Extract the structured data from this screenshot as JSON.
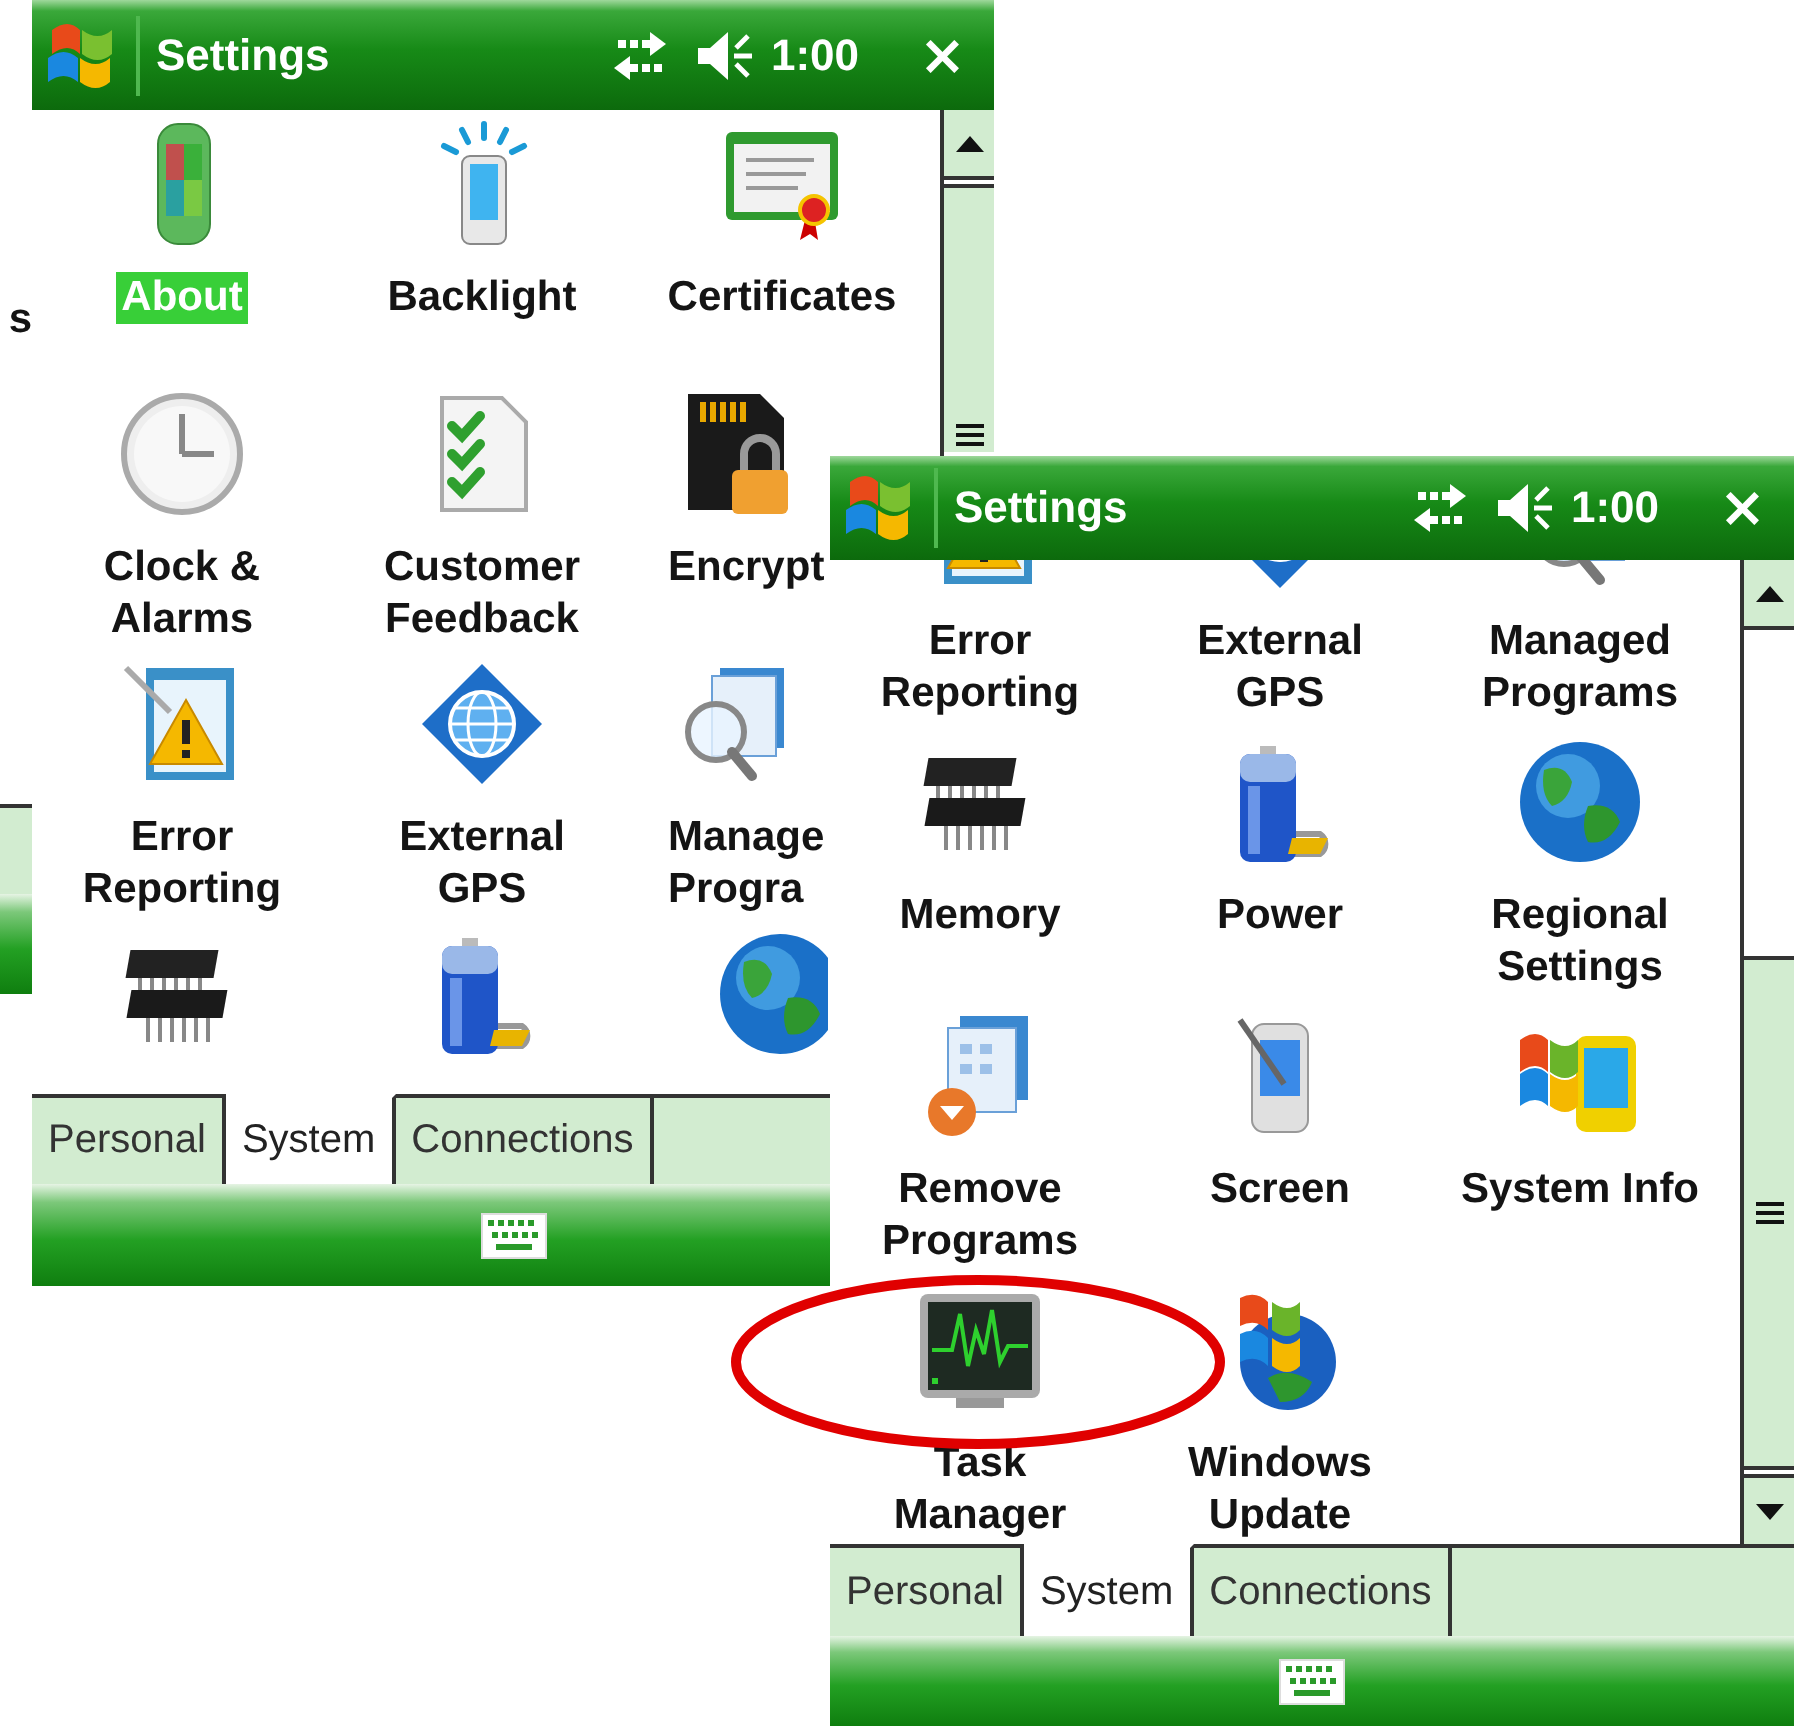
{
  "background_window": {
    "label": "s"
  },
  "windows": [
    {
      "title": "Settings",
      "time": "1:00",
      "close": "×",
      "items": [
        {
          "label": "About",
          "selected": true
        },
        {
          "label": "Backlight",
          "selected": false
        },
        {
          "label": "Certificates",
          "selected": false
        },
        {
          "label": "Clock &\nAlarms",
          "selected": false
        },
        {
          "label": "Customer\nFeedback",
          "selected": false
        },
        {
          "label": "Encrypt",
          "selected": false
        },
        {
          "label": "Error\nReporting",
          "selected": false
        },
        {
          "label": "External\nGPS",
          "selected": false
        },
        {
          "label": "Manage\nProgra",
          "selected": false
        },
        {
          "selected": false
        },
        {
          "selected": false
        },
        {
          "selected": false
        }
      ],
      "tabs": [
        {
          "label": "Personal",
          "selected": false
        },
        {
          "label": "System",
          "selected": true
        },
        {
          "label": "Connections",
          "selected": false
        }
      ]
    },
    {
      "title": "Settings",
      "time": "1:00",
      "close": "×",
      "items": [
        {
          "label": "Error\nReporting",
          "selected": false
        },
        {
          "label": "External\nGPS",
          "selected": false
        },
        {
          "label": "Managed\nPrograms",
          "selected": false
        },
        {
          "label": "Memory",
          "selected": false
        },
        {
          "label": "Power",
          "selected": false
        },
        {
          "label": "Regional\nSettings",
          "selected": false
        },
        {
          "label": "Remove\nPrograms",
          "selected": false
        },
        {
          "label": "Screen",
          "selected": false
        },
        {
          "label": "System Info",
          "selected": false
        },
        {
          "label": "Task\nManager",
          "selected": false
        },
        {
          "label": "Windows\nUpdate",
          "selected": false
        }
      ],
      "tabs": [
        {
          "label": "Personal",
          "selected": false
        },
        {
          "label": "System",
          "selected": true
        },
        {
          "label": "Connections",
          "selected": false
        }
      ]
    }
  ]
}
